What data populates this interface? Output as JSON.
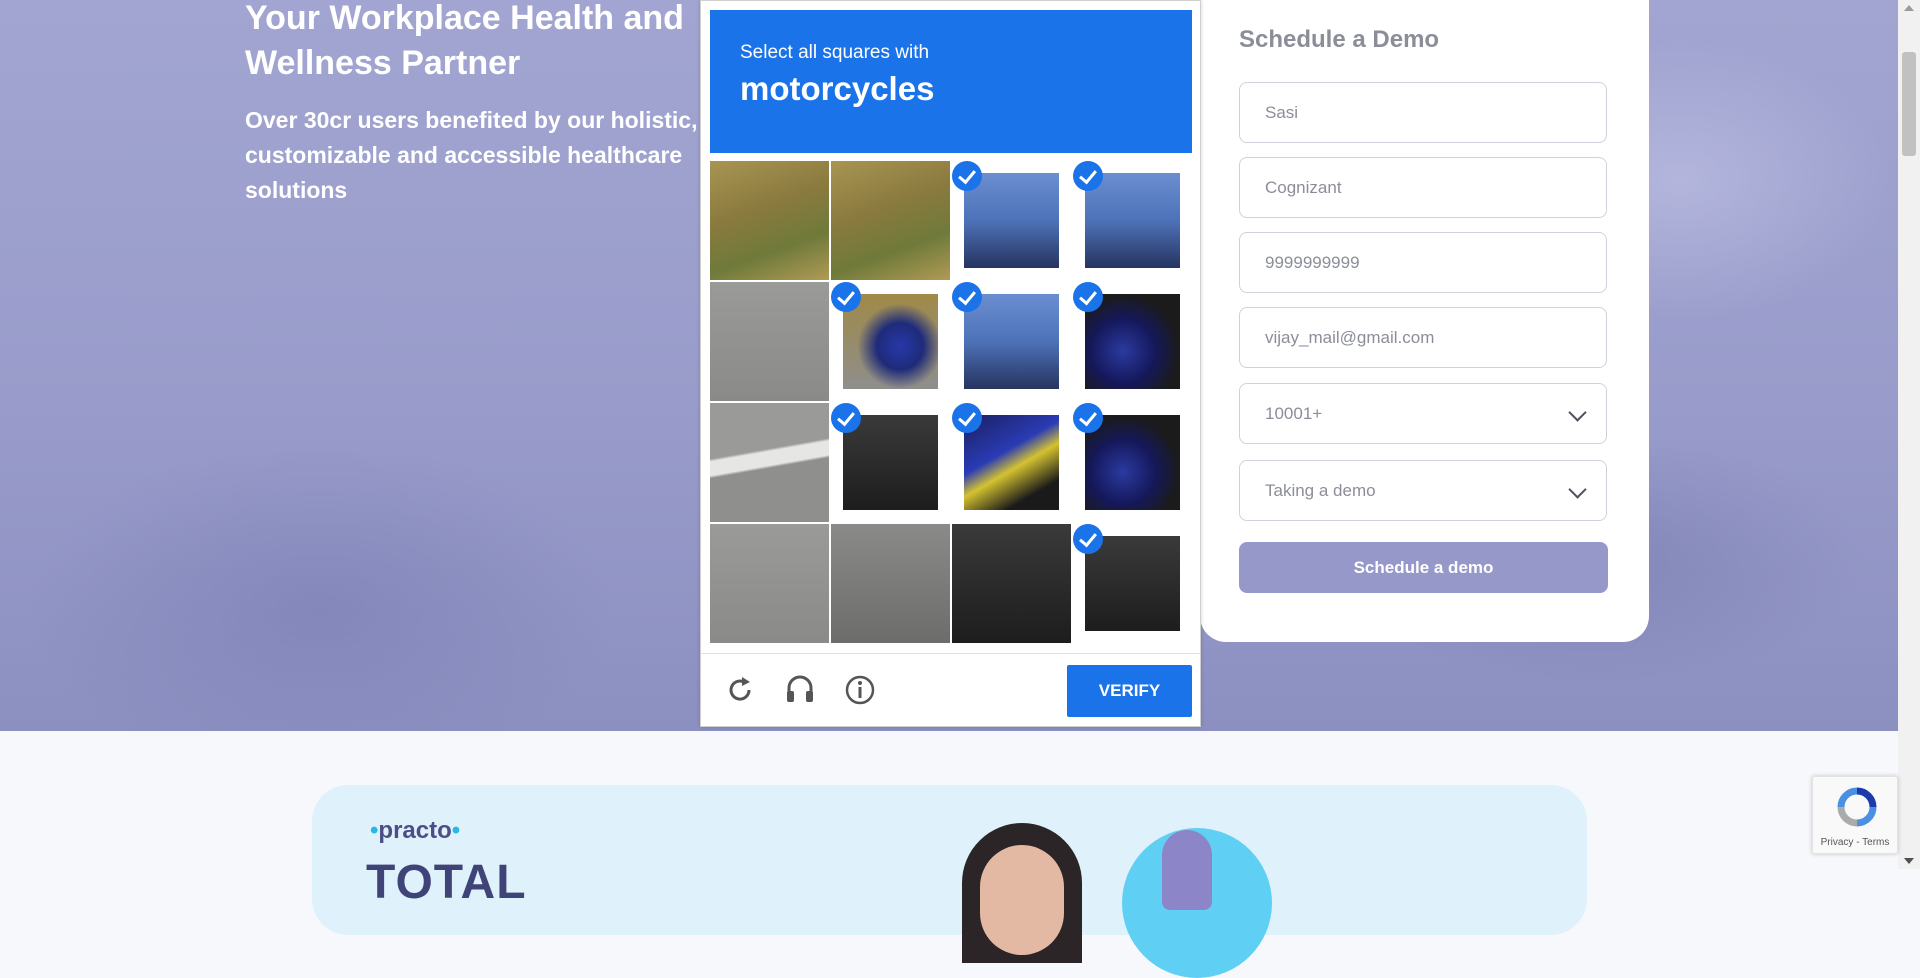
{
  "hero": {
    "heading": "Your Workplace Health and Wellness Partner",
    "subheading": "Over 30cr users benefited by our holistic, customizable and accessible healthcare solutions"
  },
  "form": {
    "title": "Schedule a Demo",
    "name_value": "Sasi",
    "company_value": "Cognizant",
    "phone_value": "9999999999",
    "email_value": "vijay_mail@gmail.com",
    "employees_selected": "10001+",
    "interest_selected": "Taking a demo",
    "submit_label": "Schedule a demo"
  },
  "captcha": {
    "instruction": "Select all squares with",
    "keyword": "motorcycles",
    "verify_label": "VERIFY",
    "grid_rows": 4,
    "grid_cols": 4,
    "selected_tiles": [
      2,
      3,
      5,
      6,
      7,
      9,
      10,
      11,
      15
    ],
    "footer_icons": [
      "reload-icon",
      "audio-icon",
      "info-icon"
    ]
  },
  "promo": {
    "logo": "practo",
    "headline": "TOTAL"
  },
  "recaptcha_badge": {
    "terms": "Privacy - Terms"
  },
  "colors": {
    "captcha_blue": "#1a73e8",
    "hero_purple": "#9c9fcd",
    "submit_button": "#9598c9"
  }
}
